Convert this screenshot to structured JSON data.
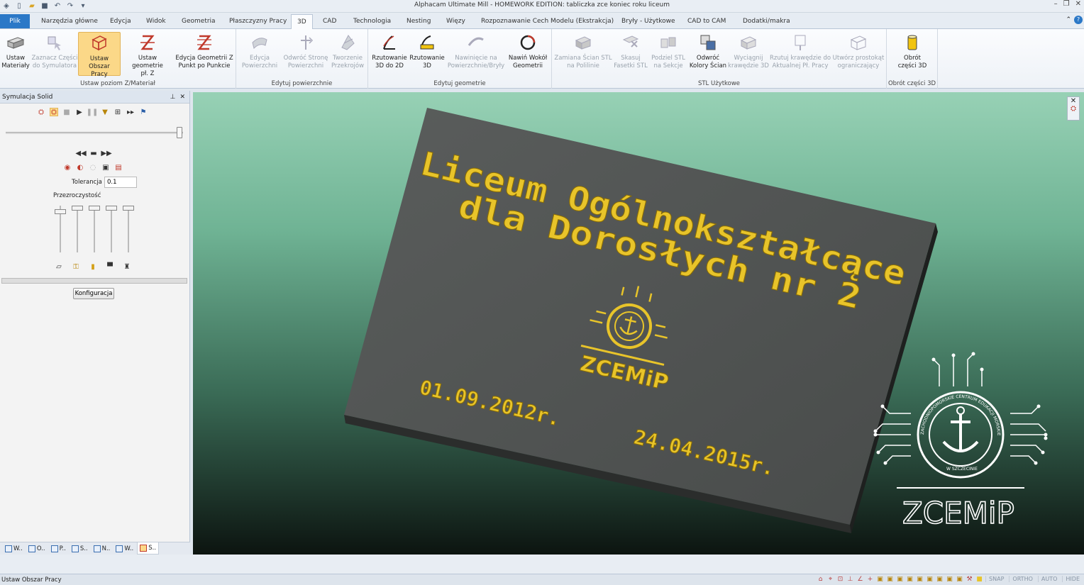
{
  "window": {
    "title": "Alphacam Ultimate Mill - HOMEWORK EDITION: tabliczka zce koniec roku liceum"
  },
  "tabs": [
    {
      "label": "Plik"
    },
    {
      "label": "Narzędzia główne"
    },
    {
      "label": "Edycja"
    },
    {
      "label": "Widok"
    },
    {
      "label": "Geometria"
    },
    {
      "label": "Płaszczyzny Pracy"
    },
    {
      "label": "3D"
    },
    {
      "label": "CAD"
    },
    {
      "label": "Technologia"
    },
    {
      "label": "Nesting"
    },
    {
      "label": "Więzy"
    },
    {
      "label": "Rozpoznawanie Cech Modelu (Ekstrakcja)"
    },
    {
      "label": "Bryły - Użytkowe"
    },
    {
      "label": "CAD to CAM"
    },
    {
      "label": "Dodatki/makra"
    }
  ],
  "ribbon": {
    "groups": [
      {
        "label": "Ustaw poziom Z/Materiał"
      },
      {
        "label": "Edytuj powierzchnie"
      },
      {
        "label": "Edytuj geometrie"
      },
      {
        "label": "STL Użytkowe"
      },
      {
        "label": "Obrót części 3D"
      }
    ],
    "buttons": [
      {
        "l1": "Ustaw",
        "l2": "Materiały"
      },
      {
        "l1": "Zaznacz Części",
        "l2": "do Symulatora"
      },
      {
        "l1": "Ustaw Obszar",
        "l2": "Pracy"
      },
      {
        "l1": "Ustaw geometrie",
        "l2": "pł. Z"
      },
      {
        "l1": "Edycja Geometrii Z",
        "l2": "Punkt po Punkcie"
      },
      {
        "l1": "Edycja",
        "l2": "Powierzchni"
      },
      {
        "l1": "Odwróć Stronę",
        "l2": "Powierzchni"
      },
      {
        "l1": "Tworzenie",
        "l2": "Przekrojów"
      },
      {
        "l1": "Rzutowanie",
        "l2": "3D do 2D"
      },
      {
        "l1": "Rzutowanie",
        "l2": "3D"
      },
      {
        "l1": "Nawinięcie na",
        "l2": "Powierzchnie/Bryły"
      },
      {
        "l1": "Nawiń Wokół",
        "l2": "Geometrii"
      },
      {
        "l1": "Zamiana Ścian STL",
        "l2": "na Polilinie"
      },
      {
        "l1": "Skasuj",
        "l2": "Fasetki STL"
      },
      {
        "l1": "Podziel STL",
        "l2": "na Sekcje"
      },
      {
        "l1": "Odwróć",
        "l2": "Kolory Ścian"
      },
      {
        "l1": "Wyciągnij",
        "l2": "krawędzie 3D"
      },
      {
        "l1": "Rzutuj krawędzie do",
        "l2": "Aktualnej Pł. Pracy"
      },
      {
        "l1": "Utwórz prostokąt",
        "l2": "ograniczający"
      },
      {
        "l1": "Obrót",
        "l2": "części 3D"
      }
    ]
  },
  "panel": {
    "title": "Symulacja Solid",
    "tolerance_label": "Tolerancja",
    "tolerance_value": "0.1",
    "transparency_label": "Przezroczystość",
    "config_button": "Konfiguracja",
    "transparency_levels": [
      0.08,
      0,
      0,
      0,
      0
    ],
    "speed_fraction": 1.0,
    "bottom_tabs": [
      {
        "label": "W.."
      },
      {
        "label": "O.."
      },
      {
        "label": "P.."
      },
      {
        "label": "S.."
      },
      {
        "label": "N.."
      },
      {
        "label": "W.."
      },
      {
        "label": "S.."
      }
    ]
  },
  "viewport": {
    "plate_line1": "Liceum Ogólnokształcące",
    "plate_line2": "dla Dorosłych nr 2",
    "plate_logo": "ZCEMiP",
    "plate_date1": "01.09.2012r.",
    "plate_date2": "24.04.2015r.",
    "watermark_logo": "ZCEMiP",
    "watermark_ring": "ZACHODNIOPOMORSKIE CENTRUM EDUKACJI MORSKIEJ I POLITECHNICZNEJ",
    "watermark_city": "W SZCZECINIE",
    "colors": {
      "plate": "#505352",
      "plate_side": "#2b2d2c",
      "engraving": "#e8c42a"
    }
  },
  "status": {
    "text": "Ustaw Obszar Pracy",
    "toggles": [
      "SNAP",
      "ORTHO",
      "AUTO",
      "HIDE"
    ]
  }
}
